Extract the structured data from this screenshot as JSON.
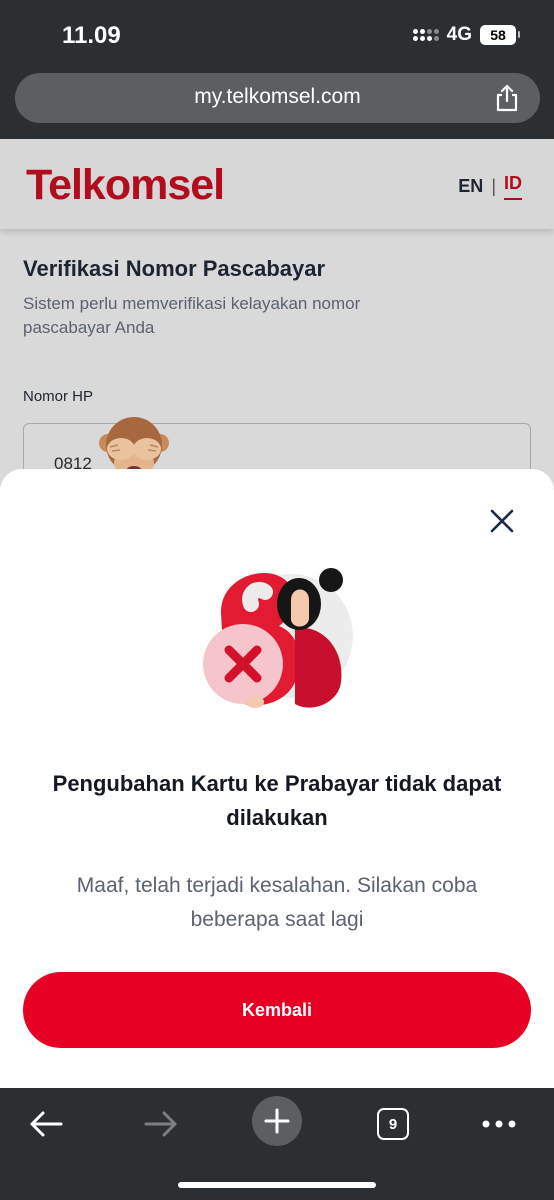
{
  "status_bar": {
    "time": "11.09",
    "network": "4G",
    "battery": "58"
  },
  "browser": {
    "url": "my.telkomsel.com",
    "tabs_count": "9"
  },
  "site": {
    "logo": "Telkomsel",
    "lang_en": "EN",
    "lang_separator": "|",
    "lang_id": "ID"
  },
  "form": {
    "title": "Verifikasi Nomor Pascabayar",
    "subtitle": "Sistem perlu memverifikasi kelayakan nomor pascabayar Anda",
    "phone_label": "Nomor HP",
    "phone_value": "0812"
  },
  "sheet": {
    "title": "Pengubahan Kartu ke Prabayar tidak dapat dilakukan",
    "message": "Maaf, telah terjadi kesalahan. Silakan coba beberapa saat lagi",
    "button_label": "Kembali"
  },
  "colors": {
    "brand_red": "#e60024",
    "logo_red": "#b10d1f",
    "chrome_bg": "#2c2f31"
  },
  "icons": [
    "share-icon",
    "close-icon",
    "back-arrow-icon",
    "forward-arrow-icon",
    "plus-icon",
    "more-icon"
  ]
}
